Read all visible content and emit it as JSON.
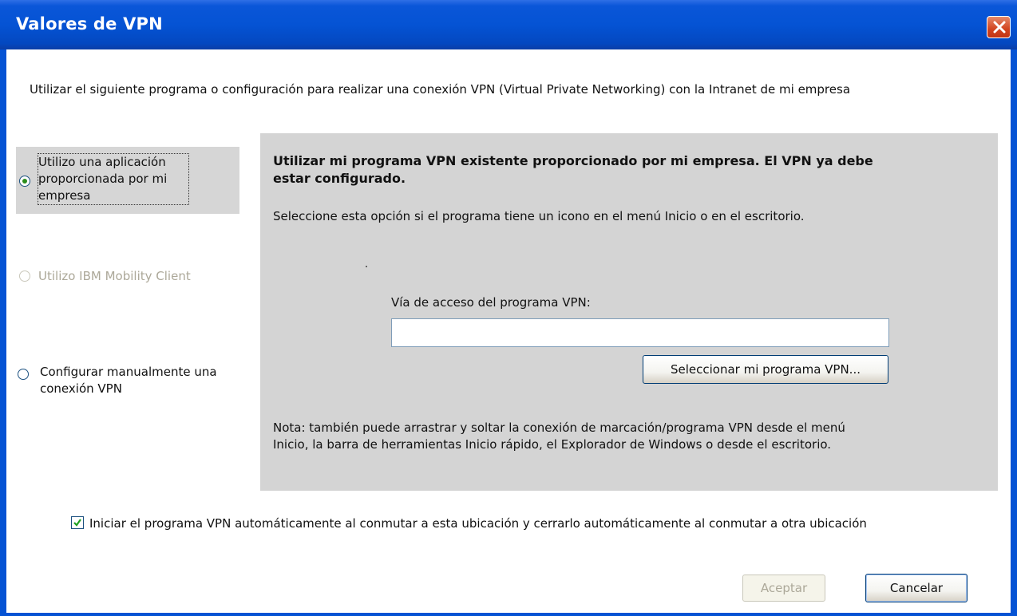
{
  "window": {
    "title": "Valores de VPN"
  },
  "intro_text": "Utilizar el siguiente programa o configuración para realizar una conexión VPN (Virtual Private Networking) con la Intranet de mi empresa",
  "options": [
    {
      "label_line1": "Utilizo una aplicación",
      "label_line2": "proporcionada por mi",
      "label_line3": "empresa",
      "selected": true,
      "enabled": true
    },
    {
      "label": "Utilizo IBM Mobility Client",
      "selected": false,
      "enabled": false
    },
    {
      "label_line1": "Configurar manualmente una",
      "label_line2": "conexión VPN",
      "selected": false,
      "enabled": true
    }
  ],
  "panel": {
    "title_line1": "Utilizar mi programa VPN existente proporcionado por mi empresa.  El VPN ya debe",
    "title_line2": "estar configurado.",
    "description": "Seleccione esta opción si el programa tiene un icono en el menú Inicio o en el escritorio.",
    "path_label": "Vía de acceso del programa VPN:",
    "path_value": "",
    "select_button": "Seleccionar mi programa VPN...",
    "note_line1": "Nota: también puede arrastrar y soltar la conexión de marcación/programa VPN desde el menú",
    "note_line2": "Inicio, la barra de herramientas Inicio rápido, el Explorador de Windows o desde el escritorio."
  },
  "auto_start": {
    "checked": true,
    "label": "Iniciar el programa VPN automáticamente al conmutar a esta ubicación y cerrarlo automáticamente al conmutar a otra ubicación"
  },
  "buttons": {
    "ok": "Aceptar",
    "cancel": "Cancelar"
  },
  "icons": {
    "close": "close-icon",
    "check": "checkmark-icon"
  },
  "colors": {
    "titlebar": "#0553d4",
    "close": "#d2441f",
    "panel": "#d4d4d4",
    "radio_dot": "#2c8d1c"
  }
}
